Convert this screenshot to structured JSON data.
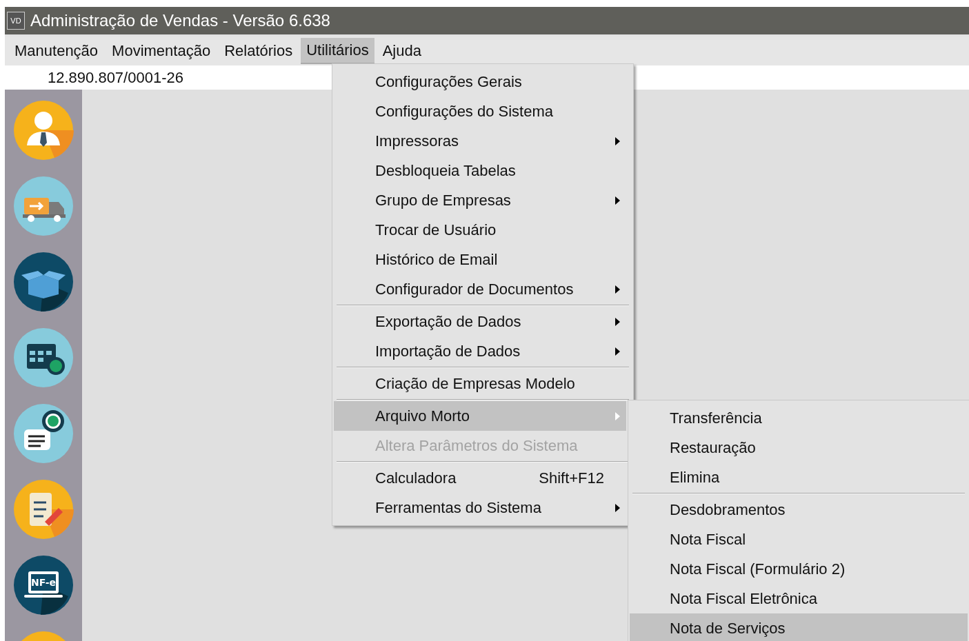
{
  "window": {
    "app_icon_text": "VD",
    "title": "Administração de Vendas - Versão 6.638"
  },
  "menubar": [
    {
      "label": "Manutenção",
      "selected": false
    },
    {
      "label": "Movimentação",
      "selected": false
    },
    {
      "label": "Relatórios",
      "selected": false
    },
    {
      "label": "Utilitários",
      "selected": true
    },
    {
      "label": "Ajuda",
      "selected": false
    }
  ],
  "company_id": "12.890.807/0001-26",
  "sidebar": [
    {
      "kind": "person"
    },
    {
      "kind": "truck"
    },
    {
      "kind": "box"
    },
    {
      "kind": "calendar"
    },
    {
      "kind": "invoice"
    },
    {
      "kind": "checklist"
    },
    {
      "kind": "laptop",
      "label": "NF-e"
    },
    {
      "kind": "partial"
    }
  ],
  "menu": [
    {
      "kind": "item",
      "label": "Configurações Gerais",
      "submenu": false,
      "disabled": false,
      "selected": false
    },
    {
      "kind": "item",
      "label": "Configurações do Sistema",
      "submenu": false,
      "disabled": false,
      "selected": false
    },
    {
      "kind": "item",
      "label": "Impressoras",
      "submenu": true,
      "disabled": false,
      "selected": false
    },
    {
      "kind": "item",
      "label": "Desbloqueia Tabelas",
      "submenu": false,
      "disabled": false,
      "selected": false
    },
    {
      "kind": "item",
      "label": "Grupo de Empresas",
      "submenu": true,
      "disabled": false,
      "selected": false
    },
    {
      "kind": "item",
      "label": "Trocar de Usuário",
      "submenu": false,
      "disabled": false,
      "selected": false
    },
    {
      "kind": "item",
      "label": "Histórico de Email",
      "submenu": false,
      "disabled": false,
      "selected": false
    },
    {
      "kind": "item",
      "label": "Configurador de Documentos",
      "submenu": true,
      "disabled": false,
      "selected": false
    },
    {
      "kind": "separator"
    },
    {
      "kind": "item",
      "label": "Exportação de Dados",
      "submenu": true,
      "disabled": false,
      "selected": false
    },
    {
      "kind": "item",
      "label": "Importação de Dados",
      "submenu": true,
      "disabled": false,
      "selected": false
    },
    {
      "kind": "separator"
    },
    {
      "kind": "item",
      "label": "Criação de Empresas Modelo",
      "submenu": false,
      "disabled": false,
      "selected": false
    },
    {
      "kind": "separator"
    },
    {
      "kind": "item",
      "label": "Arquivo Morto",
      "submenu": true,
      "disabled": false,
      "selected": true
    },
    {
      "kind": "item",
      "label": "Altera Parâmetros do Sistema",
      "submenu": false,
      "disabled": true,
      "selected": false
    },
    {
      "kind": "separator"
    },
    {
      "kind": "item",
      "label": "Calculadora",
      "shortcut": "Shift+F12",
      "submenu": false,
      "disabled": false,
      "selected": false
    },
    {
      "kind": "item",
      "label": "Ferramentas do Sistema",
      "submenu": true,
      "disabled": false,
      "selected": false
    }
  ],
  "submenu": [
    {
      "kind": "item",
      "label": "Transferência",
      "selected": false
    },
    {
      "kind": "item",
      "label": "Restauração",
      "selected": false
    },
    {
      "kind": "item",
      "label": "Elimina",
      "selected": false
    },
    {
      "kind": "separator"
    },
    {
      "kind": "item",
      "label": "Desdobramentos",
      "selected": false
    },
    {
      "kind": "item",
      "label": "Nota Fiscal",
      "selected": false
    },
    {
      "kind": "item",
      "label": "Nota Fiscal (Formulário 2)",
      "selected": false
    },
    {
      "kind": "item",
      "label": "Nota Fiscal Eletrônica",
      "selected": false
    },
    {
      "kind": "item",
      "label": "Nota de Serviços",
      "selected": true
    }
  ]
}
